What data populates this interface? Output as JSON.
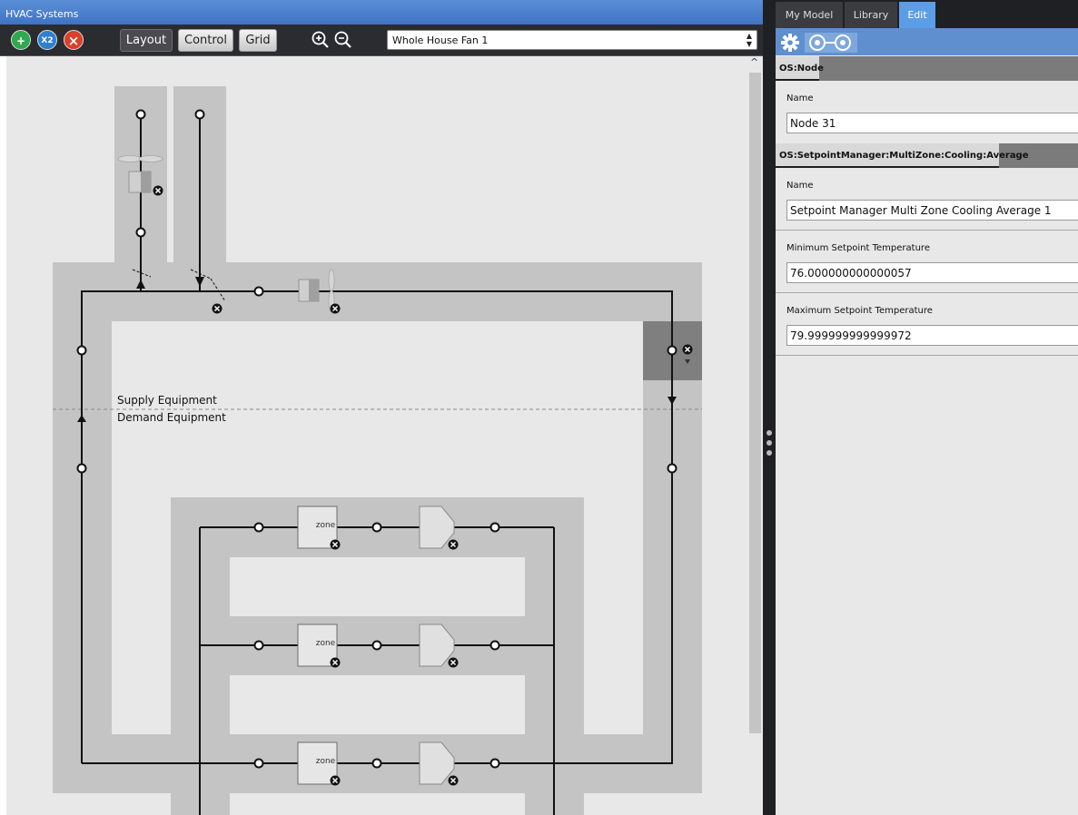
{
  "window": {
    "title": "HVAC Systems"
  },
  "toolbar": {
    "add_icon_glyph": "+",
    "duplicate_icon_glyph": "X2",
    "delete_icon_glyph": "×",
    "layout_label": "Layout",
    "control_label": "Control",
    "grid_label": "Grid",
    "system_selected": "Whole House Fan 1"
  },
  "diagram": {
    "supply_label": "Supply Equipment",
    "demand_label": "Demand Equipment",
    "zone_labels": [
      "zone",
      "zone",
      "zone"
    ],
    "scroll_up_glyph": "^"
  },
  "inspector": {
    "tabs": [
      "My Model",
      "Library",
      "Edit"
    ],
    "active_tab": "Edit",
    "sections": [
      {
        "header": "OS:Node",
        "fields": [
          {
            "label": "Name",
            "value": "Node 31"
          }
        ]
      },
      {
        "header": "OS:SetpointManager:MultiZone:Cooling:Average",
        "fields": [
          {
            "label": "Name",
            "value": "Setpoint Manager Multi Zone Cooling Average 1"
          },
          {
            "label": "Minimum Setpoint Temperature",
            "value": "76.000000000000057"
          },
          {
            "label": "Maximum Setpoint Temperature",
            "value": "79.999999999999972"
          }
        ]
      }
    ]
  },
  "colors": {
    "title_bar": "#4a80cc",
    "toolbar_bg": "#2b2c30",
    "canvas_bg": "#e8e8e8",
    "loop_band": "#c4c4c4",
    "active_tab": "#5c9ee6",
    "inspector_toolbar": "#5f8fcf",
    "add_green": "#2fa84f",
    "duplicate_blue": "#2f7fd0",
    "delete_red": "#d9402b"
  },
  "icons": [
    "add-icon",
    "duplicate-icon",
    "delete-icon",
    "zoom-in-icon",
    "zoom-out-icon",
    "gear-icon",
    "setpoint-icon",
    "fan-icon",
    "damper-icon",
    "diffuser-icon",
    "zone-icon",
    "node-icon",
    "remove-icon"
  ]
}
